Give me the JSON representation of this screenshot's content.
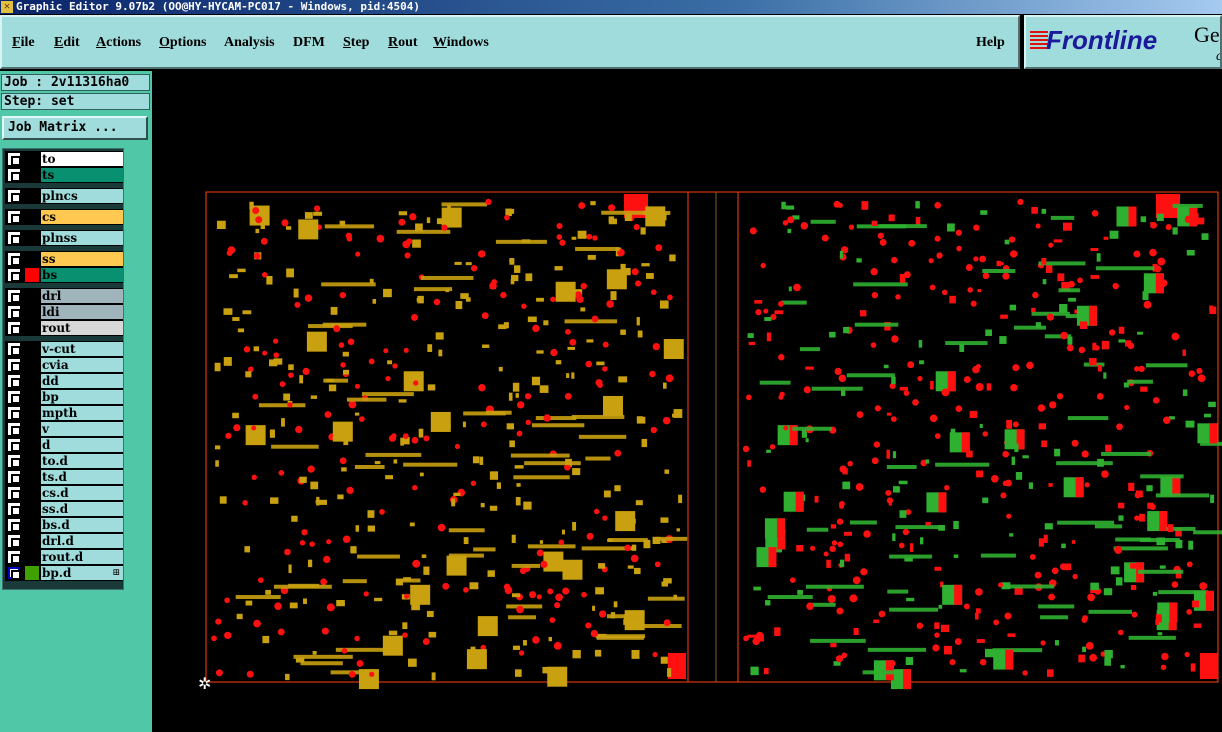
{
  "window": {
    "title": "Graphic Editor 9.07b2 (OO@HY-HYCAM-PC017 - Windows, pid:4504)"
  },
  "menu": [
    {
      "label": "File",
      "u": "F"
    },
    {
      "label": "Edit",
      "u": "E"
    },
    {
      "label": "Actions",
      "u": "A"
    },
    {
      "label": "Options",
      "u": "O"
    },
    {
      "label": "Analysis",
      "u": ""
    },
    {
      "label": "DFM",
      "u": ""
    },
    {
      "label": "Step",
      "u": "S"
    },
    {
      "label": "Rout",
      "u": "R"
    },
    {
      "label": "Windows",
      "u": "W"
    }
  ],
  "help": "Help",
  "logo": {
    "brand": "Frontline",
    "suffix": "Ge",
    "sub": "c"
  },
  "job": "Job : 2v11316ha0",
  "step": "Step: set",
  "job_matrix": "Job Matrix ...",
  "layers": [
    {
      "name": "to",
      "color": "#ffffff"
    },
    {
      "name": "ts",
      "color": "#089070"
    },
    {
      "name": "plncs",
      "color": "#a0dcdc"
    },
    {
      "name": "cs",
      "color": "#ffc850"
    },
    {
      "name": "plnss",
      "color": "#a0dcdc"
    },
    {
      "name": "ss",
      "color": "#ffc850"
    },
    {
      "name": "bs",
      "color": "#089070",
      "swatch": "#ff0000"
    },
    {
      "name": "drl",
      "color": "#a0b4bc"
    },
    {
      "name": "ldi",
      "color": "#a0b4bc"
    },
    {
      "name": "rout",
      "color": "#d8d8d8"
    },
    {
      "name": "v-cut",
      "color": "#a0dcdc"
    },
    {
      "name": "cvia",
      "color": "#a0dcdc"
    },
    {
      "name": "dd",
      "color": "#a0dcdc"
    },
    {
      "name": "bp",
      "color": "#a0dcdc"
    },
    {
      "name": "mpth",
      "color": "#a0dcdc"
    },
    {
      "name": "v",
      "color": "#a0dcdc"
    },
    {
      "name": "d",
      "color": "#a0dcdc"
    },
    {
      "name": "to.d",
      "color": "#a0dcdc"
    },
    {
      "name": "ts.d",
      "color": "#a0dcdc"
    },
    {
      "name": "cs.d",
      "color": "#a0dcdc"
    },
    {
      "name": "ss.d",
      "color": "#a0dcdc"
    },
    {
      "name": "bs.d",
      "color": "#a0dcdc"
    },
    {
      "name": "drl.d",
      "color": "#a0dcdc"
    },
    {
      "name": "rout.d",
      "color": "#a0dcdc"
    },
    {
      "name": "bp.d",
      "color": "#a0dcdc",
      "swatch": "#40a000",
      "active": true
    }
  ],
  "colors": {
    "pad": "#ff1010",
    "copper": "#c8a010",
    "green": "#30b030",
    "outline": "#ff4010"
  }
}
